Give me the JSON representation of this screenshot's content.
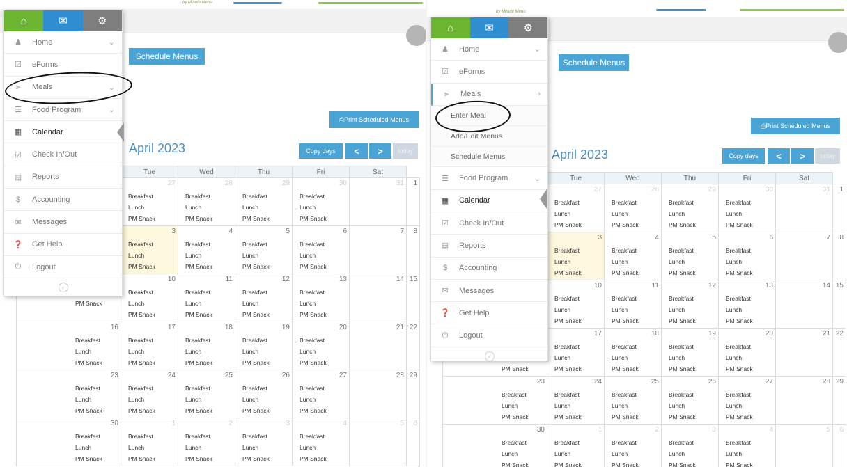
{
  "brand": {
    "tagline": "by Minute Menu"
  },
  "actions": {
    "schedule_menus": "Schedule Menus",
    "print_scheduled_menus": "Print Scheduled Menus",
    "copy_days": "Copy days",
    "prev": "<",
    "next": ">",
    "today": "today"
  },
  "calendar": {
    "month_title": "April 2023",
    "weekdays": [
      "Tue",
      "Wed",
      "Thu",
      "Fri",
      "Sat"
    ],
    "weeks": [
      {
        "days": [
          "27",
          "28",
          "29",
          "30",
          "31",
          "1"
        ],
        "muted": [
          true,
          true,
          true,
          true,
          true,
          false
        ]
      },
      {
        "days": [
          "3",
          "4",
          "5",
          "6",
          "7",
          "8"
        ],
        "muted": [
          false,
          false,
          false,
          false,
          false,
          false
        ]
      },
      {
        "days": [
          "10",
          "11",
          "12",
          "13",
          "14",
          "15"
        ],
        "muted": [
          false,
          false,
          false,
          false,
          false,
          false
        ]
      },
      {
        "days": [
          "17",
          "18",
          "19",
          "20",
          "21",
          "22"
        ],
        "muted": [
          false,
          false,
          false,
          false,
          false,
          false
        ]
      },
      {
        "days": [
          "24",
          "25",
          "26",
          "27",
          "28",
          "29"
        ],
        "muted": [
          false,
          false,
          false,
          false,
          false,
          false
        ]
      },
      {
        "days": [
          "1",
          "2",
          "3",
          "4",
          "5",
          "6"
        ],
        "muted": [
          true,
          true,
          true,
          true,
          true,
          true
        ]
      }
    ],
    "week_start_days": [
      "16",
      "23",
      "30"
    ],
    "meal_labels": [
      "Breakfast",
      "Lunch",
      "PM Snack"
    ]
  },
  "sidebar": {
    "items": [
      {
        "label": "Home",
        "icon": "group-icon",
        "chevron": "down"
      },
      {
        "label": "eForms",
        "icon": "checkbox-icon"
      },
      {
        "label": "Meals",
        "icon": "utensils-icon",
        "chevron": "down"
      },
      {
        "label": "Food Program",
        "icon": "list-icon",
        "chevron": "down"
      },
      {
        "label": "Calendar",
        "icon": "calendar-icon",
        "active": true
      },
      {
        "label": "Check In/Out",
        "icon": "checkbox-icon"
      },
      {
        "label": "Reports",
        "icon": "document-icon"
      },
      {
        "label": "Accounting",
        "icon": "dollar-icon"
      },
      {
        "label": "Messages",
        "icon": "envelope-icon"
      },
      {
        "label": "Get Help",
        "icon": "help-icon"
      },
      {
        "label": "Logout",
        "icon": "power-icon"
      }
    ],
    "meals_submenu": [
      "Enter Meal",
      "Add/Edit Menus",
      "Schedule Menus"
    ]
  },
  "colors": {
    "accent_blue": "#4aa4d6",
    "home_tab_green": "#6bb531",
    "mail_tab_blue": "#2f8dd0",
    "gear_tab_gray": "#7e7e7e",
    "today_highlight": "#fdf7dd"
  }
}
